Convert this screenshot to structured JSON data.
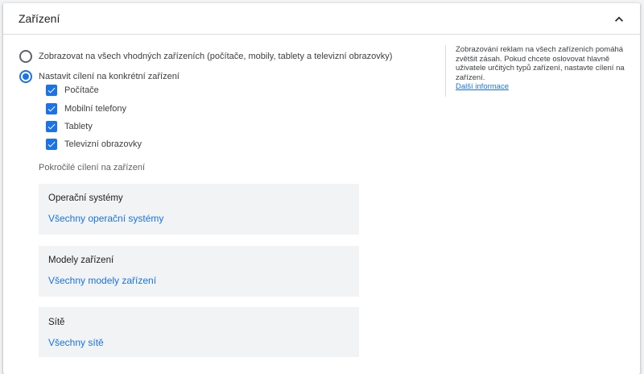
{
  "panel": {
    "title": "Zařízení"
  },
  "options": {
    "all_devices": "Zobrazovat na všech vhodných zařízeních (počítače, mobily, tablety a televizní obrazovky)",
    "specific_devices": "Nastavit cílení na konkrétní zařízení",
    "selected": "specific_devices"
  },
  "devices": [
    {
      "label": "Počítače",
      "checked": true
    },
    {
      "label": "Mobilní telefony",
      "checked": true
    },
    {
      "label": "Tablety",
      "checked": true
    },
    {
      "label": "Televizní obrazovky",
      "checked": true
    }
  ],
  "advanced": {
    "label": "Pokročilé cílení na zařízení",
    "sections": [
      {
        "title": "Operační systémy",
        "value": "Všechny operační systémy"
      },
      {
        "title": "Modely zařízení",
        "value": "Všechny modely zařízení"
      },
      {
        "title": "Sítě",
        "value": "Všechny sítě"
      }
    ]
  },
  "help": {
    "text": "Zobrazování reklam na všech zařízeních pomáhá zvětšit zásah. Pokud chcete oslovovat hlavně uživatele určitých typů zařízení, nastavte cílení na zařízení.",
    "link": "Další informace"
  },
  "icons": {
    "collapse": "chevron-up-icon",
    "checkbox": "check-icon"
  },
  "colors": {
    "accent": "#1a73e8",
    "box_background": "#f1f3f4"
  }
}
